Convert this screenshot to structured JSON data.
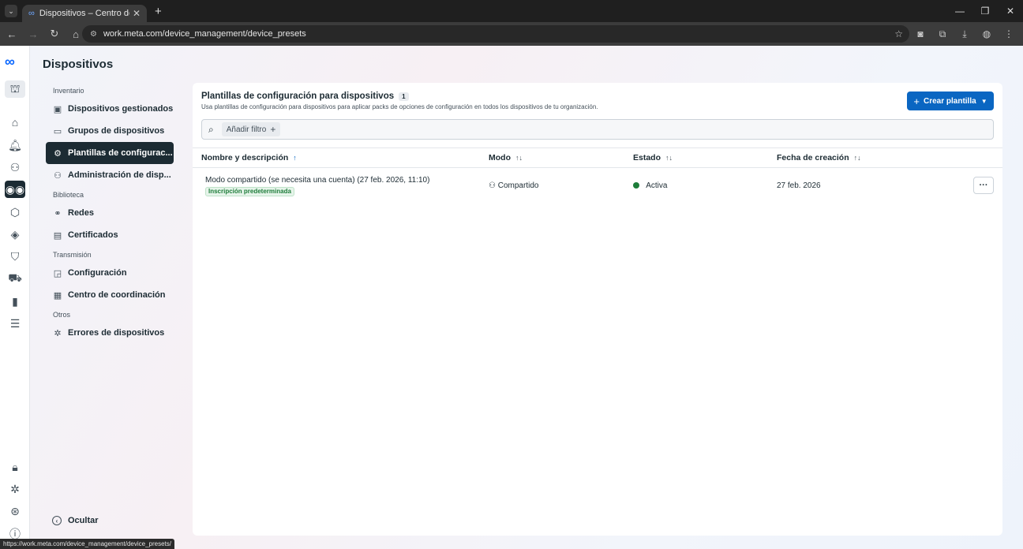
{
  "browser": {
    "tab_title": "Dispositivos – Centro de admin",
    "url": "work.meta.com/device_management/device_presets",
    "status_url": "https://work.meta.com/device_management/device_presets/"
  },
  "app": {
    "page_title": "Dispositivos",
    "hide_label": "Ocultar"
  },
  "sidebar": {
    "sections": [
      {
        "label": "Inventario"
      },
      {
        "label": "Biblioteca"
      },
      {
        "label": "Transmisión"
      },
      {
        "label": "Otros"
      }
    ],
    "items": [
      {
        "label": "Dispositivos gestionados",
        "icon": "headset-icon"
      },
      {
        "label": "Grupos de dispositivos",
        "icon": "folder-icon"
      },
      {
        "label": "Plantillas de configurac...",
        "icon": "gears-icon"
      },
      {
        "label": "Administración de disp...",
        "icon": "people-icon"
      },
      {
        "label": "Redes",
        "icon": "network-icon"
      },
      {
        "label": "Certificados",
        "icon": "certificate-icon"
      },
      {
        "label": "Configuración",
        "icon": "cast-icon"
      },
      {
        "label": "Centro de coordinación",
        "icon": "grid-icon"
      },
      {
        "label": "Errores de dispositivos",
        "icon": "bug-icon"
      }
    ]
  },
  "panel": {
    "title": "Plantillas de configuración para dispositivos",
    "count": "1",
    "subtitle": "Usa plantillas de configuración para dispositivos para aplicar packs de opciones de configuración en todos los dispositivos de tu organización.",
    "create_button": "Crear plantilla",
    "filter_label": "Añadir filtro"
  },
  "table": {
    "columns": [
      "Nombre y descripción",
      "Modo",
      "Estado",
      "Fecha de creación"
    ],
    "rows": [
      {
        "name": "Modo compartido (se necesita una cuenta) (27 feb. 2026, 11:10)",
        "badge": "Inscripción predeterminada",
        "mode": "Compartido",
        "status": "Activa",
        "created": "27 feb. 2026"
      }
    ]
  },
  "colors": {
    "accent": "#0a66c2",
    "active_nav": "#1c2b33",
    "status_active": "#1e7d3a"
  }
}
